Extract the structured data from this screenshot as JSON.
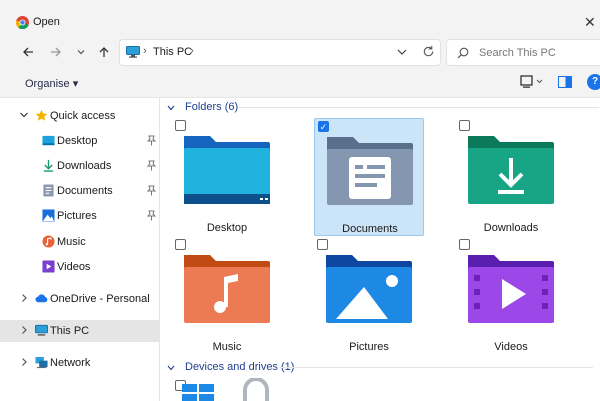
{
  "window": {
    "title": "Open"
  },
  "address": {
    "crumbs": [
      "This PC"
    ],
    "separator": "›"
  },
  "search": {
    "placeholder": "Search This PC"
  },
  "commandbar": {
    "organise_label": "Organise ▾"
  },
  "sidebar": {
    "items": [
      {
        "label": "Quick access",
        "icon": "star-icon"
      },
      {
        "label": "Desktop",
        "icon": "desktop-icon"
      },
      {
        "label": "Downloads",
        "icon": "download-icon"
      },
      {
        "label": "Documents",
        "icon": "documents-icon"
      },
      {
        "label": "Pictures",
        "icon": "pictures-icon"
      },
      {
        "label": "Music",
        "icon": "music-icon"
      },
      {
        "label": "Videos",
        "icon": "videos-icon"
      },
      {
        "label": "OneDrive - Personal",
        "icon": "cloud-icon"
      },
      {
        "label": "This PC",
        "icon": "pc-icon"
      },
      {
        "label": "Network",
        "icon": "network-icon"
      }
    ]
  },
  "main": {
    "folders_group": "Folders (6)",
    "drives_group": "Devices and drives (1)",
    "folders": [
      {
        "name": "Desktop"
      },
      {
        "name": "Documents"
      },
      {
        "name": "Downloads"
      },
      {
        "name": "Music"
      },
      {
        "name": "Pictures"
      },
      {
        "name": "Videos"
      }
    ]
  },
  "colors": {
    "accent": "#1a73e8",
    "selected_tile": "#cce4f7",
    "group_text": "#1f3f8f"
  }
}
